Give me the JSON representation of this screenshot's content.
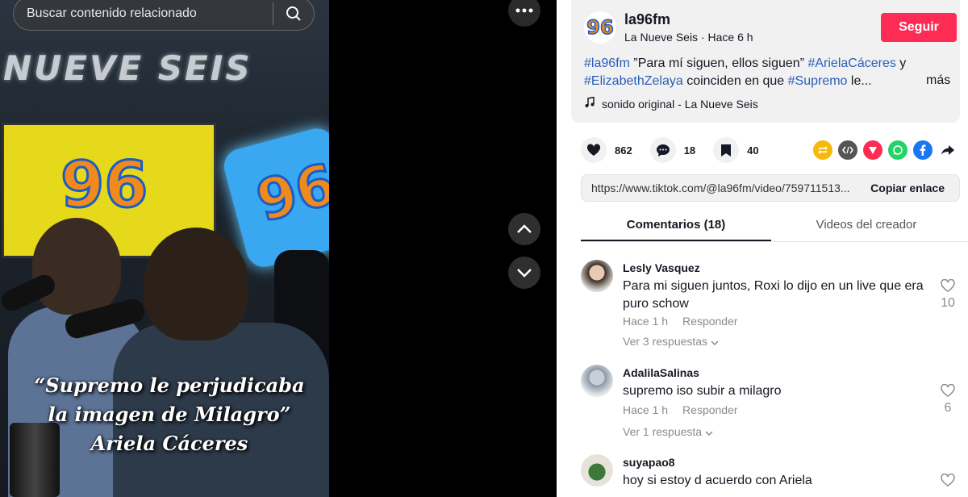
{
  "search": {
    "placeholder": "Buscar contenido relacionado",
    "icon": "search-icon"
  },
  "video": {
    "wall_sign": "NUEVE SEIS",
    "logo_text": "96",
    "caption_lines": [
      "“Supremo le perjudicaba",
      "la imagen de Milagro”",
      "Ariela Cáceres"
    ]
  },
  "controls": {
    "more_icon": "ellipsis-icon",
    "up_icon": "chevron-up-icon",
    "down_icon": "chevron-down-icon"
  },
  "author": {
    "logo_text": "96",
    "username": "la96fm",
    "subline": "La Nueve Seis · Hace 6 h",
    "follow_label": "Seguir"
  },
  "description": {
    "tag1": "#la96fm",
    "text1": " ”Para mí siguen, ellos siguen” ",
    "tag2": "#ArielaCáceres",
    "text2": " y ",
    "tag3": "#ElizabethZelaya",
    "text3": " coinciden en que ",
    "tag4": "#Supremo",
    "text4": " le...",
    "more_label": "más"
  },
  "sound": {
    "label": "sonido original - La Nueve Seis",
    "icon": "music-note-icon"
  },
  "stats": {
    "likes": "862",
    "comments": "18",
    "saves": "40"
  },
  "share_icons": [
    "repost-icon",
    "embed-icon",
    "send-icon",
    "whatsapp-icon",
    "facebook-icon",
    "share-arrow-icon"
  ],
  "colors": {
    "follow": "#fe2c55",
    "hashtag": "#2b5db9",
    "repost": "#f5b90c",
    "embed": "#555555",
    "send": "#fe2c55",
    "whatsapp": "#25d366",
    "facebook": "#1877f2"
  },
  "link": {
    "url": "https://www.tiktok.com/@la96fm/video/759711513...",
    "copy_label": "Copiar enlace"
  },
  "tabs": [
    {
      "label": "Comentarios (18)"
    },
    {
      "label": "Videos del creador"
    }
  ],
  "comments": [
    {
      "name": "Lesly Vasquez",
      "text": "Para mi siguen juntos, Roxi lo dijo en un live que era puro schow",
      "time": "Hace 1 h",
      "reply": "Responder",
      "likes": "10",
      "more": "Ver 3 respuestas"
    },
    {
      "name": "AdalilaSalinas",
      "text": "supremo iso subir a milagro",
      "time": "Hace 1 h",
      "reply": "Responder",
      "likes": "6",
      "more": "Ver 1 respuesta"
    },
    {
      "name": "suyapao8",
      "text": "hoy si estoy d acuerdo con Ariela"
    }
  ]
}
